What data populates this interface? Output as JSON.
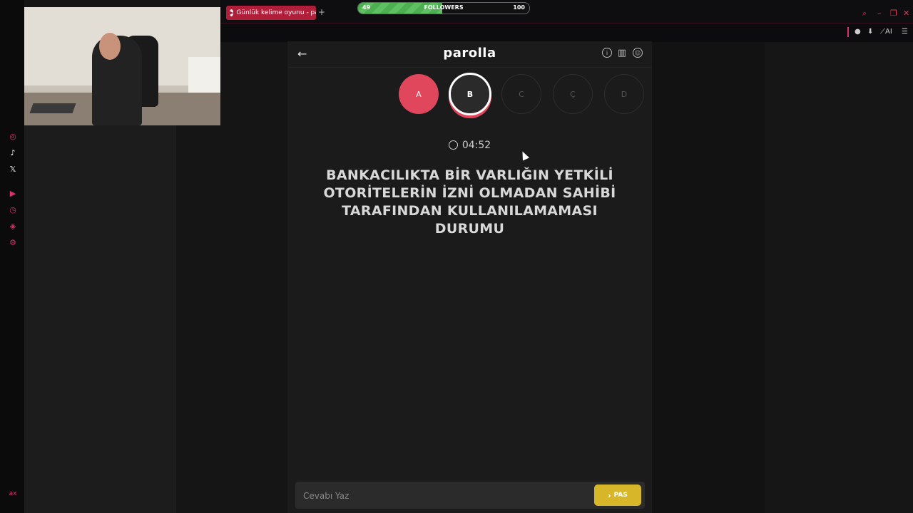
{
  "browser": {
    "tab_title": "Günlük kelime oyunu - par",
    "new_tab_glyph": "+",
    "window_controls": [
      "⌕",
      "–",
      "❐",
      "✕"
    ],
    "toolbar_icons": [
      "person-icon",
      "download-icon",
      "ai-icon",
      "menu-icon"
    ],
    "ai_label": "AI",
    "rail_label": "ax"
  },
  "followers": {
    "current": "49",
    "label": "FOLLOWERS",
    "goal": "100",
    "progress_fraction": 0.49
  },
  "game": {
    "brand": "parolla",
    "letters": [
      {
        "char": "A",
        "state": "done"
      },
      {
        "char": "B",
        "state": "current"
      },
      {
        "char": "C",
        "state": "pending"
      },
      {
        "char": "Ç",
        "state": "pending"
      },
      {
        "char": "D",
        "state": "pending"
      }
    ],
    "timer": "04:52",
    "question": "BANKACILIKTA BİR VARLIĞIN YETKİLİ OTORİTELERİN İZNİ OLMADAN SAHİBİ TARAFINDAN KULLANILAMAMASI DURUMU",
    "answer_placeholder": "Cevabı Yaz",
    "pas_label": "PAS"
  },
  "colors": {
    "accent": "#e0475d",
    "pas": "#d8b62a",
    "tab": "#b01e3a"
  }
}
